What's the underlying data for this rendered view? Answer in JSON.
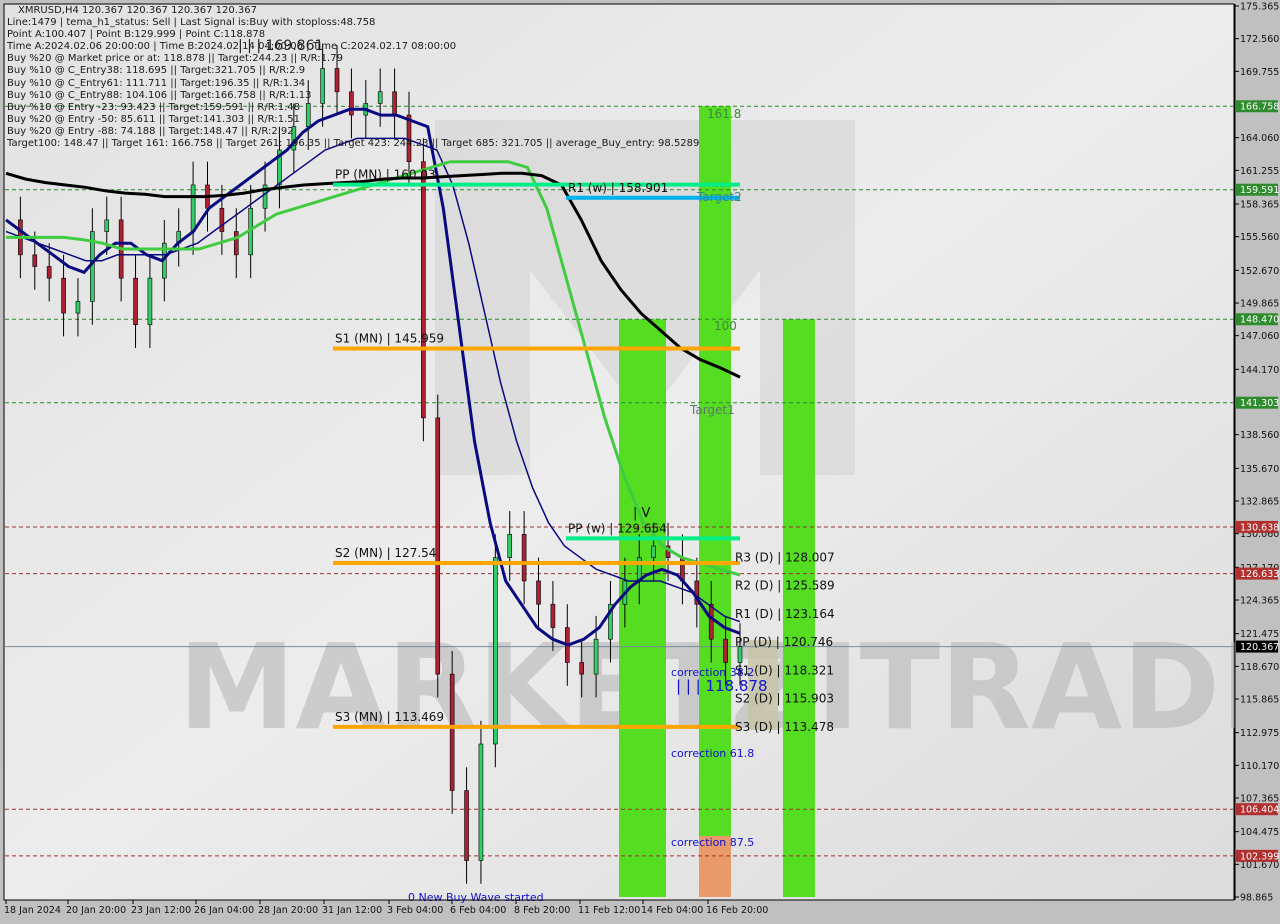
{
  "header": {
    "symbol_line": "XMRUSD,H4  120.367 120.367 120.367 120.367",
    "info_lines": [
      "Line:1479 | tema_h1_status: Sell | Last Signal is:Buy with stoploss:48.758",
      "Point A:100.407 | Point B:129.999 | Point C:118.878",
      "Time A:2024.02.06 20:00:00 | Time B:2024.02.14 04:00:00 | Time C:2024.02.17 08:00:00",
      "Buy %20 @ Market price or at: 118.878 || Target:244.23 || R/R:1.79",
      "Buy %10 @ C_Entry38: 118.695 || Target:321.705 || R/R:2.9",
      "Buy %10 @ C_Entry61: 111.711 || Target:196.35 || R/R:1.34",
      "Buy %10 @ C_Entry88: 104.106 || Target:166.758 || R/R:1.13",
      "Buy %10 @ Entry -23: 93.423 || Target:159.591 || R/R:1.48",
      "Buy %20 @ Entry -50: 85.611 || Target:141.303 || R/R:1.51",
      "Buy %20 @ Entry -88: 74.188 || Target:148.47 || R/R:2.92",
      "Target100: 148.47 || Target 161: 166.758 || Target 261: 196.35 || Target 423: 244.23 || Target 685: 321.705 || average_Buy_entry: 98.5289"
    ],
    "overlay_label": "| | | 169.861"
  },
  "watermark": "MARKETZITRADE",
  "chart_data": {
    "type": "line",
    "title": "XMRUSD,H4",
    "ylim": [
      98.865,
      175.365
    ],
    "grid": false,
    "y_ticks": [
      "175.365",
      "172.560",
      "169.755",
      "164.060",
      "161.255",
      "158.365",
      "155.560",
      "152.670",
      "149.865",
      "147.060",
      "144.170",
      "138.560",
      "135.670",
      "132.865",
      "130.060",
      "127.170",
      "124.365",
      "121.475",
      "118.670",
      "115.865",
      "112.975",
      "110.170",
      "107.365",
      "104.475",
      "101.670",
      "98.865"
    ],
    "y_tick_values": [
      175.365,
      172.56,
      169.755,
      164.06,
      161.255,
      158.365,
      155.56,
      152.67,
      149.865,
      147.06,
      144.17,
      138.56,
      135.67,
      132.865,
      130.06,
      127.17,
      124.365,
      121.475,
      118.67,
      115.865,
      112.975,
      110.17,
      107.365,
      104.475,
      101.67,
      98.865
    ],
    "x_ticks": [
      "18 Jan 2024",
      "20 Jan 20:00",
      "23 Jan 12:00",
      "26 Jan 04:00",
      "28 Jan 20:00",
      "31 Jan 12:00",
      "3 Feb 04:00",
      "6 Feb 04:00",
      "8 Feb 20:00",
      "11 Feb 12:00",
      "14 Feb 04:00",
      "16 Feb 20:00"
    ],
    "current_price": {
      "label": "120.367",
      "value": 120.367,
      "color": "#000000"
    },
    "price_badges": [
      {
        "label": "166.758",
        "value": 166.758,
        "color": "#2e8b2e",
        "line": "green"
      },
      {
        "label": "159.591",
        "value": 159.591,
        "color": "#2e8b2e",
        "line": "green"
      },
      {
        "label": "148.470",
        "value": 148.47,
        "color": "#2e8b2e",
        "line": "green"
      },
      {
        "label": "141.303",
        "value": 141.303,
        "color": "#2e8b2e",
        "line": "green"
      },
      {
        "label": "130.638",
        "value": 130.638,
        "color": "#b03030",
        "line": "red"
      },
      {
        "label": "126.633",
        "value": 126.633,
        "color": "#b03030",
        "line": "red"
      },
      {
        "label": "106.404",
        "value": 106.404,
        "color": "#b03030",
        "line": "red"
      },
      {
        "label": "102.399",
        "value": 102.399,
        "color": "#b03030",
        "line": "red"
      }
    ],
    "pivot_levels": [
      {
        "label": "PP (MN) | 160.03",
        "value": 160.03,
        "color": "#00ee88"
      },
      {
        "label": "S1 (MN) | 145.959",
        "value": 145.959,
        "color": "#ffa500"
      },
      {
        "label": "S2 (MN) | 127.54",
        "value": 127.54,
        "color": "#ffa500"
      },
      {
        "label": "S3 (MN) | 113.469",
        "value": 113.469,
        "color": "#ffa500"
      },
      {
        "label": "R1 (w) | 158.901",
        "value": 158.901,
        "color": "#00b0f0"
      },
      {
        "label": "PP (w) | 129.654",
        "value": 129.654,
        "color": "#00ee88"
      }
    ],
    "daily_pivots": [
      {
        "label": "R3 (D) | 128.007",
        "value": 128.007
      },
      {
        "label": "R2 (D) | 125.589",
        "value": 125.589
      },
      {
        "label": "R1 (D) | 123.164",
        "value": 123.164
      },
      {
        "label": "PP (D) | 120.746",
        "value": 120.746
      },
      {
        "label": "S1 (D) | 118.321",
        "value": 118.321
      },
      {
        "label": "S2 (D) | 115.903",
        "value": 115.903
      },
      {
        "label": "S3 (D) | 113.478",
        "value": 113.478
      }
    ],
    "annotations": [
      {
        "text": "161.8",
        "value": 166.758
      },
      {
        "text": "100",
        "value": 148.47
      },
      {
        "text": "Target1",
        "value": 141.303
      },
      {
        "text": "Target2",
        "value": 158.901
      },
      {
        "text": "correction 38.2",
        "value": 118.878
      },
      {
        "text": "| | | 118.878",
        "value": 118.878
      },
      {
        "text": "correction 61.8",
        "value": 111.711
      },
      {
        "text": "correction 87.5",
        "value": 104.106
      },
      {
        "text": "0 New Buy Wave started",
        "value": 98.865
      },
      {
        "text": "| V",
        "value": 131
      }
    ],
    "zones": [
      {
        "name": "zone-a",
        "from": 98.865,
        "to": 148.47,
        "color": "#55dd22"
      },
      {
        "name": "zone-b-green",
        "from": 104.106,
        "to": 166.758,
        "color": "#55dd22"
      },
      {
        "name": "zone-b-orange",
        "from": 98.865,
        "to": 104.106,
        "color": "#e89a6a"
      },
      {
        "name": "zone-c",
        "from": 98.865,
        "to": 148.47,
        "color": "#55dd22"
      }
    ],
    "series": [
      {
        "name": "close",
        "color": "#8b1a2a",
        "values": [
          157,
          154,
          153,
          152,
          149,
          150,
          156,
          157,
          152,
          148,
          152,
          155,
          156,
          160,
          158,
          156,
          154,
          158,
          160,
          163,
          165,
          167,
          170,
          168,
          166,
          167,
          168,
          166,
          162,
          140,
          118,
          108,
          102,
          112,
          128,
          130,
          126,
          124,
          122,
          119,
          118,
          121,
          124,
          126,
          128,
          129,
          128,
          126,
          124,
          121,
          119,
          120.367
        ]
      },
      {
        "name": "ema-fast",
        "color": "#0a0a80",
        "values": [
          157,
          156,
          155,
          154,
          153,
          152.5,
          154,
          155,
          155,
          154,
          153.5,
          155,
          156,
          158,
          159,
          160,
          161,
          162,
          163,
          164.5,
          165.5,
          166,
          166.5,
          166.5,
          166,
          166,
          165.5,
          165,
          158,
          148,
          138,
          131,
          126,
          124,
          122,
          121,
          120.5,
          121,
          122,
          124,
          125.5,
          126.5,
          127,
          126.5,
          125,
          123,
          122,
          121.5
        ]
      },
      {
        "name": "ema-mid",
        "color": "#0a0a80",
        "values": [
          156,
          155.5,
          155,
          154.5,
          154,
          153.5,
          153.5,
          154,
          154,
          154,
          154,
          154.5,
          155,
          156,
          157,
          158,
          159,
          160,
          161,
          162,
          163,
          163.5,
          164,
          164,
          164,
          164,
          163.5,
          163,
          160,
          155,
          149,
          143,
          138,
          134,
          131,
          129,
          128,
          127,
          126.5,
          126,
          126,
          126,
          125.5,
          125,
          124,
          123,
          122.5
        ]
      },
      {
        "name": "ema-green",
        "color": "#40cc40",
        "values": [
          155.5,
          155.5,
          155.5,
          155.5,
          155.3,
          155,
          154.5,
          154.5,
          154.5,
          154.5,
          154.5,
          155,
          155.5,
          156.5,
          157.5,
          158,
          158.5,
          159,
          159.5,
          160,
          160.5,
          161,
          161.5,
          162,
          162,
          162,
          162,
          161.5,
          158,
          152,
          146,
          140,
          135,
          131,
          129,
          128,
          127.5,
          127,
          126.5
        ]
      },
      {
        "name": "sma-black",
        "color": "#000000",
        "values": [
          161,
          160.5,
          160.2,
          160,
          159.8,
          159.5,
          159.3,
          159.2,
          159,
          159,
          159,
          159.1,
          159.3,
          159.6,
          159.8,
          160,
          160.1,
          160.2,
          160.3,
          160.5,
          160.6,
          160.6,
          160.7,
          160.8,
          160.9,
          161,
          161,
          160.8,
          160,
          157,
          153.5,
          151,
          149,
          147.5,
          146,
          145,
          144.3,
          143.5
        ]
      }
    ]
  }
}
